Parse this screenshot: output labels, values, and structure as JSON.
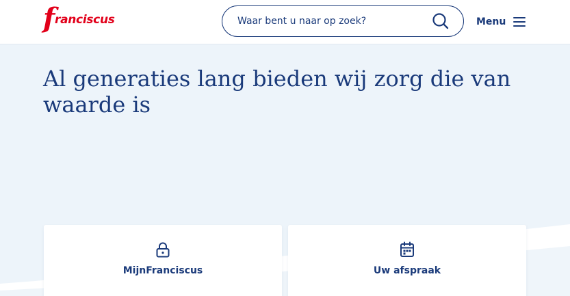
{
  "header": {
    "logo_text": "franciscus",
    "logo_initial": "f",
    "logo_rest": "ranciscus",
    "search": {
      "placeholder": "Waar bent u naar op zoek?",
      "value": "",
      "icon": "search-icon"
    },
    "menu": {
      "label": "Menu",
      "icon": "hamburger-icon"
    }
  },
  "hero": {
    "title": "Al generaties lang bieden wij zorg die van waarde is"
  },
  "cards": [
    {
      "label": "MijnFranciscus",
      "icon": "lock-icon"
    },
    {
      "label": "Uw afspraak",
      "icon": "calendar-icon"
    }
  ],
  "colors": {
    "brand_red": "#e2001a",
    "primary_navy": "#1a3a7a",
    "background": "#edf4fa",
    "card_background": "#ffffff"
  }
}
